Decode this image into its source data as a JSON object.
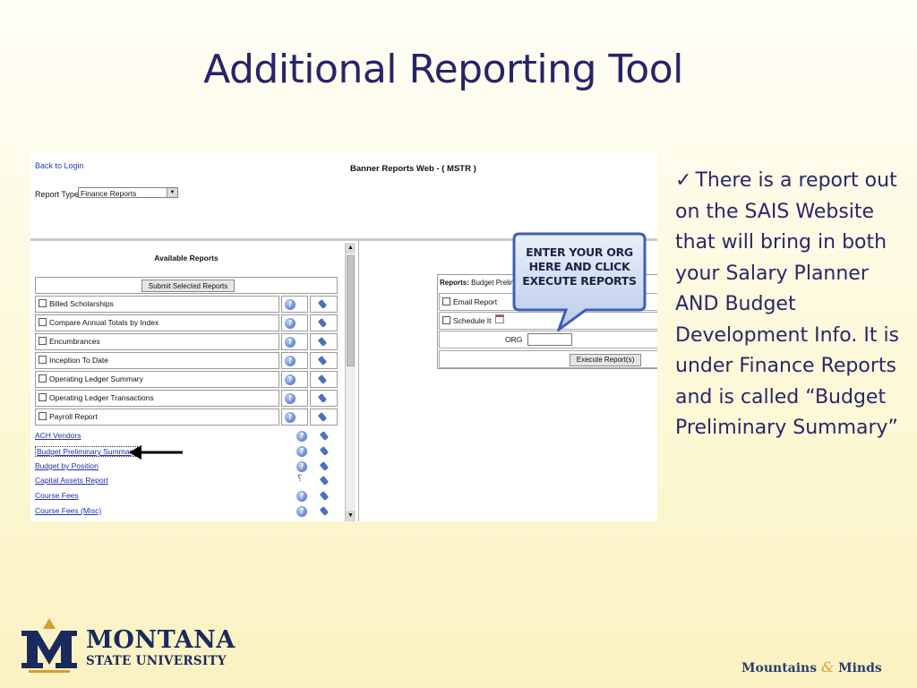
{
  "slide": {
    "title": "Additional Reporting Tool"
  },
  "screenshot": {
    "back_link": "Back to Login",
    "app_title": "Banner Reports Web - ( MSTR )",
    "report_type_label": "Report Type:",
    "report_type_value": "Finance Reports",
    "available_reports_title": "Available Reports",
    "submit_button": "Submit Selected Reports",
    "checkbox_reports": [
      "Billed Scholarships",
      "Compare Annual Totals by Index",
      "Encumbrances",
      "Inception To Date",
      "Operating Ledger Summary",
      "Operating Ledger Transactions",
      "Payroll Report"
    ],
    "link_reports": [
      "ACH Vendors",
      "Budget Preliminary Summary",
      "Budget by Position",
      "Capital Assets Report",
      "Course Fees",
      "Course Fees (Misc)"
    ],
    "right_panel": {
      "reports_label": "Reports:",
      "reports_value": "Budget Prelim",
      "email_report": "Email Report",
      "schedule_it": "Schedule It",
      "org_label": "ORG",
      "execute_button": "Execute Report(s)"
    }
  },
  "callout": {
    "lines": [
      "ENTER YOUR ORG",
      "HERE AND CLICK",
      "EXECUTE REPORTS"
    ]
  },
  "bullet": {
    "text": "There is a report out on the SAIS Website that will bring in both your Salary Planner AND Budget Development Info.  It is under Finance Reports and is called “Budget Preliminary Summary”"
  },
  "footer": {
    "university_name": "MONTANA",
    "university_sub": "STATE UNIVERSITY",
    "tagline_left": "Mountains",
    "tagline_amp": "&",
    "tagline_right": "Minds"
  },
  "colors": {
    "title": "#27246a",
    "link": "#1f2fae",
    "msu_blue": "#1b2a5c",
    "msu_gold": "#d1a02f"
  }
}
